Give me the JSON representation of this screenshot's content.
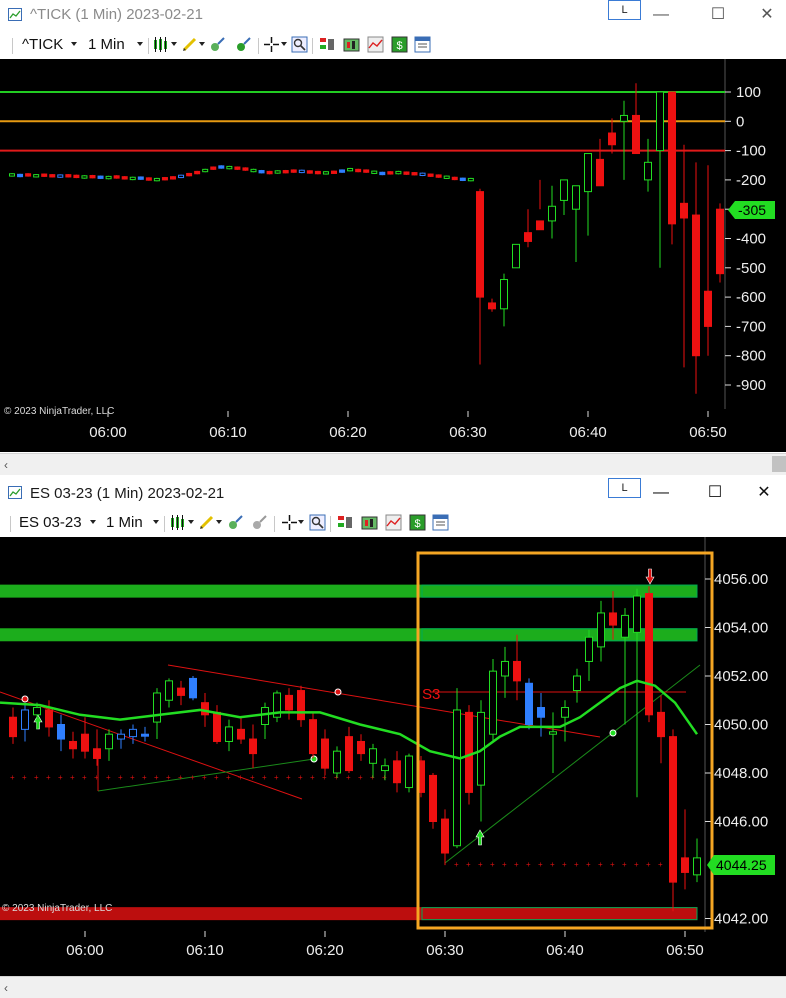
{
  "window1": {
    "title": "^TICK (1 Min)  2023-02-21",
    "link_label": "L",
    "minimize": "—",
    "maximize": "☐",
    "close": "✕",
    "instrument": "^TICK",
    "interval": "1 Min",
    "copyright": "© 2023 NinjaTrader, LLC",
    "y_ticks": [
      "100",
      "0",
      "-100",
      "-200",
      "-300",
      "-400",
      "-500",
      "-600",
      "-700",
      "-800",
      "-900"
    ],
    "x_ticks": [
      "06:00",
      "06:10",
      "06:20",
      "06:30",
      "06:40",
      "06:50"
    ],
    "last_price": "-305",
    "hlines": [
      {
        "value": 100,
        "color": "#22cc22"
      },
      {
        "value": 0,
        "color": "#e69a12"
      },
      {
        "value": -100,
        "color": "#e01a1a"
      }
    ]
  },
  "window2": {
    "title": "ES 03-23 (1 Min)  2023-02-21",
    "link_label": "L",
    "minimize": "—",
    "maximize": "☐",
    "close": "✕",
    "instrument": "ES 03-23",
    "interval": "1 Min",
    "copyright": "© 2023 NinjaTrader, LLC",
    "y_ticks": [
      "4056.00",
      "4054.00",
      "4052.00",
      "4050.00",
      "4048.00",
      "4046.00",
      "4042.00"
    ],
    "x_ticks": [
      "06:00",
      "06:10",
      "06:20",
      "06:30",
      "06:40",
      "06:50"
    ],
    "last_price": "4044.25",
    "label_s3": "S3",
    "zones": [
      {
        "value": 4055.5,
        "color": "#22cc22"
      },
      {
        "value": 4053.7,
        "color": "#22cc22"
      },
      {
        "value": 4042.2,
        "color": "#dd1111"
      }
    ]
  },
  "colors": {
    "up": "#22dd22",
    "down": "#ee1111",
    "neutral": "#2f7fff",
    "highlight_box": "#f5a623",
    "ma_line": "#22dd22"
  }
}
